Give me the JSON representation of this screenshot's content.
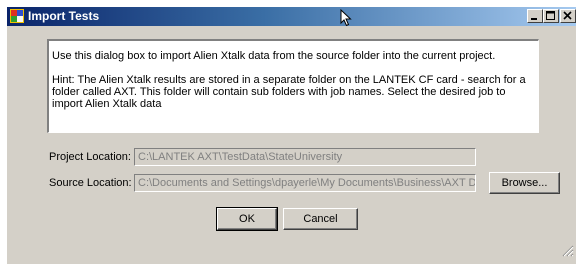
{
  "window": {
    "title": "Import Tests",
    "buttons": [
      "minimize-icon",
      "maximize-icon",
      "close-icon"
    ]
  },
  "info": {
    "line1": "Use this dialog box to import Alien Xtalk data from the source folder into the current project.",
    "line2": "Hint: The Alien Xtalk results are stored in a separate folder on the LANTEK CF card - search for a folder called AXT. This folder will contain sub folders with job names. Select the desired job to import Alien Xtalk data"
  },
  "project": {
    "label": "Project Location:",
    "value": "C:\\LANTEK AXT\\TestData\\StateUniversity"
  },
  "source": {
    "label": "Source Location:",
    "value": "C:\\Documents and Settings\\dpayerle\\My Documents\\Business\\AXT Data\\"
  },
  "buttons": {
    "browse": "Browse...",
    "ok": "OK",
    "cancel": "Cancel"
  },
  "colors": {
    "titlebar_start": "#0a246a",
    "titlebar_end": "#a6caf0",
    "dialog_bg": "#d4d0c8"
  }
}
